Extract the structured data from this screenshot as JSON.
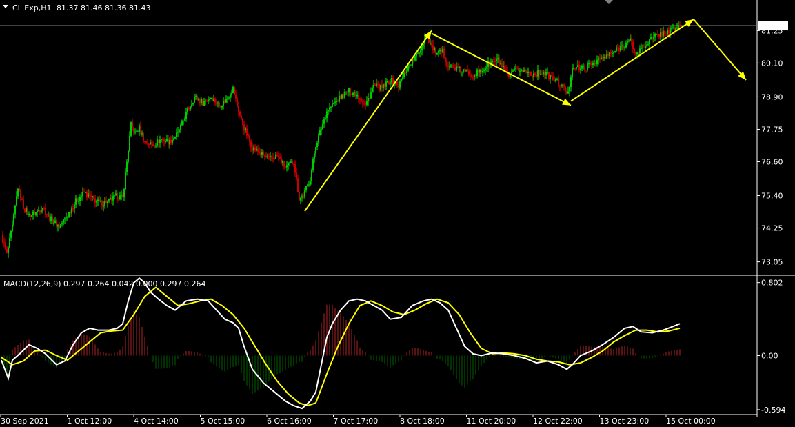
{
  "header": {
    "symbol": "CL.Exp,H1",
    "ohlc": "81.37 81.46 81.36 81.43"
  },
  "macd_header": "MACD(12,26,9) 0.297 0.264 0.042 0.000 0.297 0.264",
  "colors": {
    "background": "#000000",
    "bull": "#00ff00",
    "bear": "#ff0000",
    "grid_frame": "#ffffff",
    "price_line": "#808080",
    "arrow": "#ffff00",
    "macd_line": "#ffffff",
    "signal_line": "#ffff00",
    "hist_pos": "#b22222",
    "hist_neg": "#006400"
  },
  "chart_data": [
    {
      "type": "candlestick",
      "price_ylim": [
        72.6,
        81.7
      ],
      "price_ticks": [
        "81.25",
        "80.10",
        "78.90",
        "77.75",
        "76.60",
        "75.40",
        "74.25",
        "73.05"
      ],
      "current_price": "81.43",
      "x_tick_labels": [
        "30 Sep 2021",
        "1 Oct 12:00",
        "4 Oct 14:00",
        "5 Oct 15:00",
        "6 Oct 16:00",
        "7 Oct 17:00",
        "8 Oct 18:00",
        "11 Oct 20:00",
        "12 Oct 22:00",
        "13 Oct 23:00",
        "15 Oct 00:00"
      ],
      "close_path": [
        [
          0,
          74.0
        ],
        [
          4,
          73.3
        ],
        [
          8,
          74.3
        ],
        [
          12,
          75.7
        ],
        [
          16,
          75.0
        ],
        [
          20,
          74.7
        ],
        [
          25,
          74.8
        ],
        [
          30,
          75.0
        ],
        [
          35,
          74.6
        ],
        [
          42,
          74.3
        ],
        [
          48,
          74.7
        ],
        [
          54,
          75.2
        ],
        [
          60,
          75.5
        ],
        [
          66,
          75.3
        ],
        [
          72,
          75.1
        ],
        [
          78,
          75.2
        ],
        [
          84,
          75.4
        ],
        [
          88,
          75.3
        ],
        [
          91,
          76.6
        ],
        [
          94,
          77.9
        ],
        [
          97,
          77.6
        ],
        [
          100,
          77.8
        ],
        [
          104,
          77.3
        ],
        [
          110,
          77.2
        ],
        [
          116,
          77.4
        ],
        [
          122,
          77.3
        ],
        [
          128,
          77.6
        ],
        [
          134,
          78.3
        ],
        [
          140,
          78.9
        ],
        [
          146,
          78.7
        ],
        [
          152,
          78.9
        ],
        [
          158,
          78.6
        ],
        [
          163,
          78.8
        ],
        [
          168,
          79.2
        ],
        [
          172,
          78.4
        ],
        [
          176,
          77.8
        ],
        [
          182,
          77.1
        ],
        [
          188,
          76.9
        ],
        [
          194,
          76.7
        ],
        [
          200,
          76.8
        ],
        [
          206,
          76.4
        ],
        [
          212,
          76.6
        ],
        [
          216,
          75.3
        ],
        [
          219,
          75.4
        ],
        [
          224,
          76.0
        ],
        [
          228,
          77.2
        ],
        [
          232,
          77.8
        ],
        [
          236,
          78.4
        ],
        [
          240,
          78.6
        ],
        [
          246,
          78.9
        ],
        [
          252,
          79.1
        ],
        [
          258,
          79.0
        ],
        [
          264,
          78.6
        ],
        [
          270,
          79.3
        ],
        [
          276,
          79.2
        ],
        [
          282,
          79.5
        ],
        [
          288,
          79.3
        ],
        [
          294,
          79.9
        ],
        [
          300,
          80.3
        ],
        [
          304,
          80.6
        ],
        [
          308,
          81.1
        ],
        [
          312,
          80.7
        ],
        [
          316,
          80.4
        ],
        [
          320,
          80.5
        ],
        [
          324,
          80.0
        ],
        [
          330,
          79.9
        ],
        [
          336,
          79.8
        ],
        [
          342,
          79.7
        ],
        [
          348,
          79.8
        ],
        [
          354,
          80.1
        ],
        [
          360,
          80.2
        ],
        [
          364,
          79.9
        ],
        [
          368,
          79.6
        ],
        [
          374,
          79.9
        ],
        [
          380,
          79.8
        ],
        [
          386,
          79.7
        ],
        [
          392,
          79.8
        ],
        [
          398,
          79.6
        ],
        [
          404,
          79.4
        ],
        [
          408,
          79.2
        ],
        [
          411,
          79.0
        ],
        [
          414,
          80.0
        ],
        [
          420,
          79.9
        ],
        [
          426,
          80.0
        ],
        [
          432,
          80.2
        ],
        [
          438,
          80.3
        ],
        [
          444,
          80.5
        ],
        [
          450,
          80.7
        ],
        [
          456,
          80.9
        ],
        [
          460,
          80.4
        ],
        [
          464,
          80.6
        ],
        [
          470,
          80.9
        ],
        [
          476,
          81.1
        ],
        [
          482,
          81.2
        ],
        [
          488,
          81.3
        ],
        [
          492,
          81.43
        ]
      ],
      "arrows": [
        {
          "from": [
            220,
            74.85
          ],
          "to": [
            312,
            81.25
          ]
        },
        {
          "from": [
            312,
            81.15
          ],
          "to": [
            413,
            78.6
          ]
        },
        {
          "from": [
            413,
            78.75
          ],
          "to": [
            502,
            81.65
          ]
        },
        {
          "from": [
            502,
            81.65
          ],
          "to": [
            540,
            79.5
          ]
        }
      ]
    },
    {
      "type": "macd",
      "params": "12,26,9",
      "ylim": [
        -0.64,
        0.86
      ],
      "y_ticks": [
        "0.802",
        "0.00",
        "-0.594"
      ],
      "macd_path": [
        [
          0,
          -0.05
        ],
        [
          5,
          -0.25
        ],
        [
          8,
          -0.05
        ],
        [
          14,
          0.03
        ],
        [
          20,
          0.12
        ],
        [
          26,
          0.08
        ],
        [
          32,
          0.02
        ],
        [
          40,
          -0.1
        ],
        [
          46,
          -0.06
        ],
        [
          52,
          0.12
        ],
        [
          58,
          0.25
        ],
        [
          64,
          0.3
        ],
        [
          70,
          0.28
        ],
        [
          78,
          0.28
        ],
        [
          84,
          0.3
        ],
        [
          88,
          0.35
        ],
        [
          92,
          0.6
        ],
        [
          96,
          0.8
        ],
        [
          100,
          0.85
        ],
        [
          104,
          0.8
        ],
        [
          108,
          0.7
        ],
        [
          114,
          0.62
        ],
        [
          120,
          0.55
        ],
        [
          126,
          0.5
        ],
        [
          134,
          0.6
        ],
        [
          142,
          0.62
        ],
        [
          150,
          0.6
        ],
        [
          156,
          0.5
        ],
        [
          162,
          0.4
        ],
        [
          168,
          0.36
        ],
        [
          172,
          0.3
        ],
        [
          176,
          0.1
        ],
        [
          182,
          -0.15
        ],
        [
          190,
          -0.3
        ],
        [
          198,
          -0.4
        ],
        [
          206,
          -0.5
        ],
        [
          212,
          -0.55
        ],
        [
          218,
          -0.58
        ],
        [
          224,
          -0.5
        ],
        [
          228,
          -0.4
        ],
        [
          232,
          -0.1
        ],
        [
          236,
          0.2
        ],
        [
          240,
          0.35
        ],
        [
          246,
          0.5
        ],
        [
          252,
          0.6
        ],
        [
          258,
          0.62
        ],
        [
          264,
          0.6
        ],
        [
          270,
          0.55
        ],
        [
          276,
          0.5
        ],
        [
          282,
          0.4
        ],
        [
          290,
          0.42
        ],
        [
          298,
          0.55
        ],
        [
          306,
          0.6
        ],
        [
          312,
          0.62
        ],
        [
          318,
          0.58
        ],
        [
          324,
          0.5
        ],
        [
          330,
          0.3
        ],
        [
          336,
          0.1
        ],
        [
          342,
          0.02
        ],
        [
          348,
          0.0
        ],
        [
          356,
          0.03
        ],
        [
          364,
          0.02
        ],
        [
          372,
          0.0
        ],
        [
          380,
          -0.03
        ],
        [
          388,
          -0.08
        ],
        [
          396,
          -0.06
        ],
        [
          404,
          -0.1
        ],
        [
          410,
          -0.15
        ],
        [
          414,
          -0.1
        ],
        [
          420,
          0.0
        ],
        [
          428,
          0.05
        ],
        [
          436,
          0.12
        ],
        [
          444,
          0.2
        ],
        [
          452,
          0.3
        ],
        [
          458,
          0.32
        ],
        [
          464,
          0.26
        ],
        [
          472,
          0.25
        ],
        [
          480,
          0.28
        ],
        [
          487,
          0.32
        ],
        [
          492,
          0.35
        ]
      ],
      "signal_path": [
        [
          0,
          -0.02
        ],
        [
          8,
          -0.1
        ],
        [
          16,
          -0.06
        ],
        [
          24,
          0.05
        ],
        [
          32,
          0.06
        ],
        [
          40,
          0.0
        ],
        [
          48,
          -0.05
        ],
        [
          56,
          0.05
        ],
        [
          64,
          0.15
        ],
        [
          72,
          0.25
        ],
        [
          80,
          0.27
        ],
        [
          88,
          0.28
        ],
        [
          96,
          0.45
        ],
        [
          104,
          0.65
        ],
        [
          112,
          0.75
        ],
        [
          120,
          0.65
        ],
        [
          128,
          0.55
        ],
        [
          136,
          0.57
        ],
        [
          144,
          0.6
        ],
        [
          152,
          0.62
        ],
        [
          160,
          0.55
        ],
        [
          168,
          0.45
        ],
        [
          176,
          0.3
        ],
        [
          184,
          0.1
        ],
        [
          192,
          -0.1
        ],
        [
          200,
          -0.28
        ],
        [
          208,
          -0.42
        ],
        [
          216,
          -0.52
        ],
        [
          222,
          -0.55
        ],
        [
          228,
          -0.52
        ],
        [
          236,
          -0.2
        ],
        [
          244,
          0.1
        ],
        [
          252,
          0.35
        ],
        [
          260,
          0.55
        ],
        [
          268,
          0.6
        ],
        [
          276,
          0.55
        ],
        [
          284,
          0.48
        ],
        [
          292,
          0.45
        ],
        [
          300,
          0.5
        ],
        [
          308,
          0.57
        ],
        [
          316,
          0.62
        ],
        [
          324,
          0.58
        ],
        [
          332,
          0.45
        ],
        [
          340,
          0.25
        ],
        [
          348,
          0.08
        ],
        [
          356,
          0.02
        ],
        [
          364,
          0.03
        ],
        [
          372,
          0.02
        ],
        [
          380,
          0.0
        ],
        [
          388,
          -0.04
        ],
        [
          396,
          -0.06
        ],
        [
          404,
          -0.07
        ],
        [
          412,
          -0.1
        ],
        [
          420,
          -0.08
        ],
        [
          428,
          -0.02
        ],
        [
          436,
          0.05
        ],
        [
          444,
          0.15
        ],
        [
          452,
          0.22
        ],
        [
          460,
          0.28
        ],
        [
          468,
          0.28
        ],
        [
          476,
          0.26
        ],
        [
          484,
          0.27
        ],
        [
          492,
          0.3
        ]
      ]
    }
  ]
}
